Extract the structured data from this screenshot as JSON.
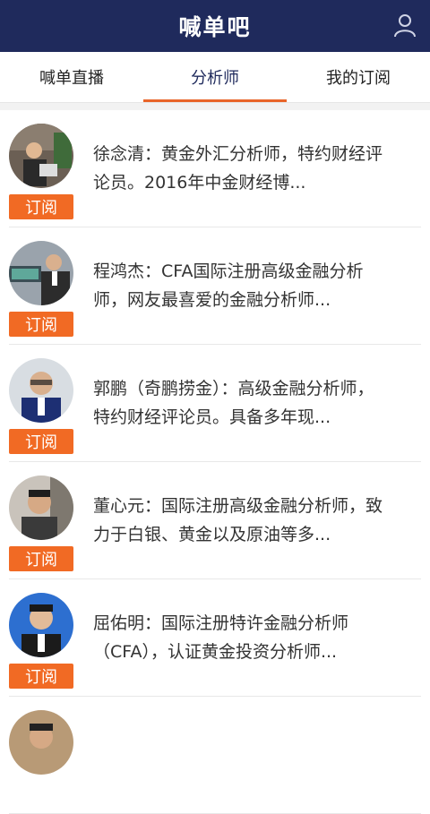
{
  "header": {
    "title": "喊单吧"
  },
  "tabs": [
    {
      "label": "喊单直播",
      "active": false
    },
    {
      "label": "分析师",
      "active": true
    },
    {
      "label": "我的订阅",
      "active": false
    }
  ],
  "subscribe_label": "订阅",
  "analysts": [
    {
      "line1": "徐念清：黄金外汇分析师，特约财经评",
      "line2": "论员。2016年中金财经博..."
    },
    {
      "line1": "程鸿杰：CFA国际注册高级金融分析",
      "line2": "师，网友最喜爱的金融分析师..."
    },
    {
      "line1": "郭鹏（奇鹏捞金）：高级金融分析师，",
      "line2": "特约财经评论员。具备多年现..."
    },
    {
      "line1": "董心元：国际注册高级金融分析师，致",
      "line2": "力于白银、黄金以及原油等多..."
    },
    {
      "line1": "屈佑明：国际注册特许金融分析师",
      "line2": "（CFA），认证黄金投资分析师..."
    }
  ],
  "colors": {
    "header_bg": "#1f2a5c",
    "accent": "#e9652a",
    "subscribe_bg": "#f16a24"
  }
}
